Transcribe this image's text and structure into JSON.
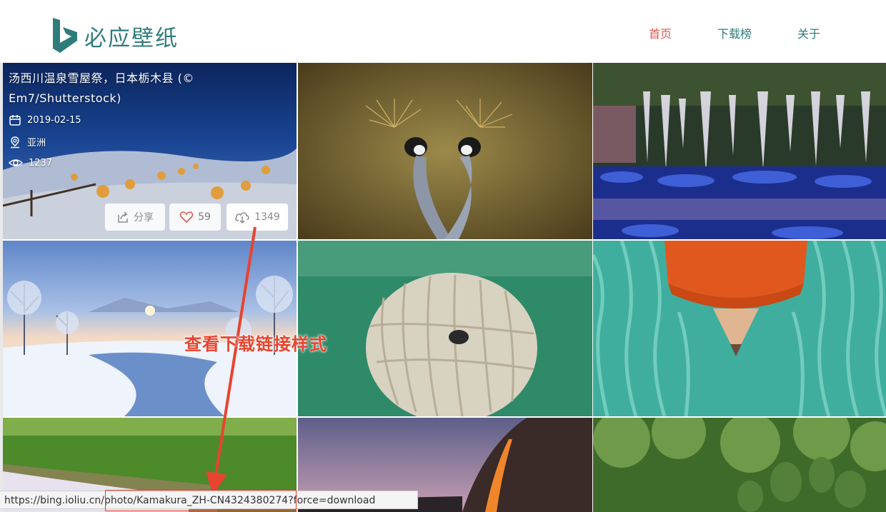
{
  "header": {
    "brand": "必应壁纸",
    "nav": [
      {
        "label": "首页",
        "active": true
      },
      {
        "label": "下载榜",
        "active": false
      },
      {
        "label": "关于",
        "active": false
      }
    ],
    "brand_color": "#2f7d7a",
    "active_color": "#e2574c"
  },
  "featured": {
    "title": "汤西川温泉雪屋祭，日本栃木县 (© Em7/Shutterstock)",
    "date": "2019-02-15",
    "location": "亚洲",
    "views": "1237",
    "share_label": "分享",
    "likes": "59",
    "downloads": "1349"
  },
  "annotation": {
    "text": "查看下载链接样式",
    "color": "#e8432f"
  },
  "statusbar": {
    "url": "https://bing.ioliu.cn/photo/Kamakura_ZH-CN4324380274?force=download"
  },
  "icons": [
    "bing-logo-icon",
    "calendar-icon",
    "location-pin-icon",
    "eye-icon",
    "share-icon",
    "heart-icon",
    "cloud-download-icon"
  ]
}
